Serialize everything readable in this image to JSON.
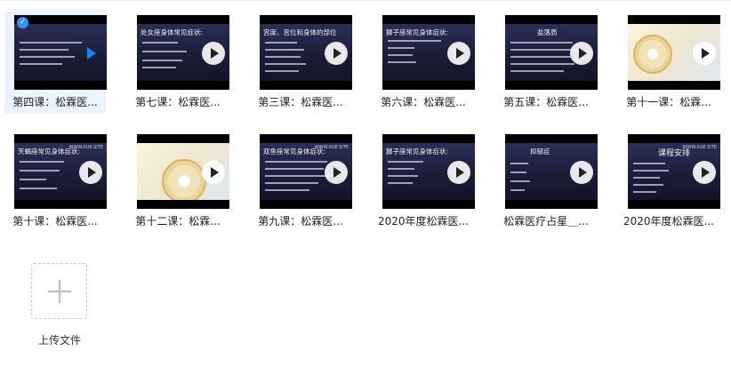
{
  "files": [
    {
      "name": "第四课：松霖医...",
      "thumb_title": "",
      "selected": true
    },
    {
      "name": "第七课：松霖医...",
      "thumb_title": "处女座身体常见症状:"
    },
    {
      "name": "第三课：松霖医...",
      "thumb_title": "宫度、宫位和身体的部位"
    },
    {
      "name": "第六课：松霖医...",
      "thumb_title": "狮子座常见身体症状:"
    },
    {
      "name": "第五课：松霖医...",
      "thumb_title": "盐落质"
    },
    {
      "name": "第十一课：松霖...",
      "thumb_title": ""
    },
    {
      "name": "第十课：松霖医...",
      "thumb_title": "天蝎座常见身体症状:"
    },
    {
      "name": "第十二课：松霖...",
      "thumb_title": ""
    },
    {
      "name": "第九课：松霖医...",
      "thumb_title": "双鱼座常见身体症状:"
    },
    {
      "name": "2020年度松霖医...",
      "thumb_title": "狮子座常见身体症状:"
    },
    {
      "name": "松霖医疗占星＿...",
      "thumb_title": "抑郁症"
    },
    {
      "name": "2020年度松霖医...",
      "thumb_title": "课程安排"
    }
  ],
  "thumb_watermark": "WWW.XUE.SITE",
  "upload": {
    "label": "上传文件"
  }
}
